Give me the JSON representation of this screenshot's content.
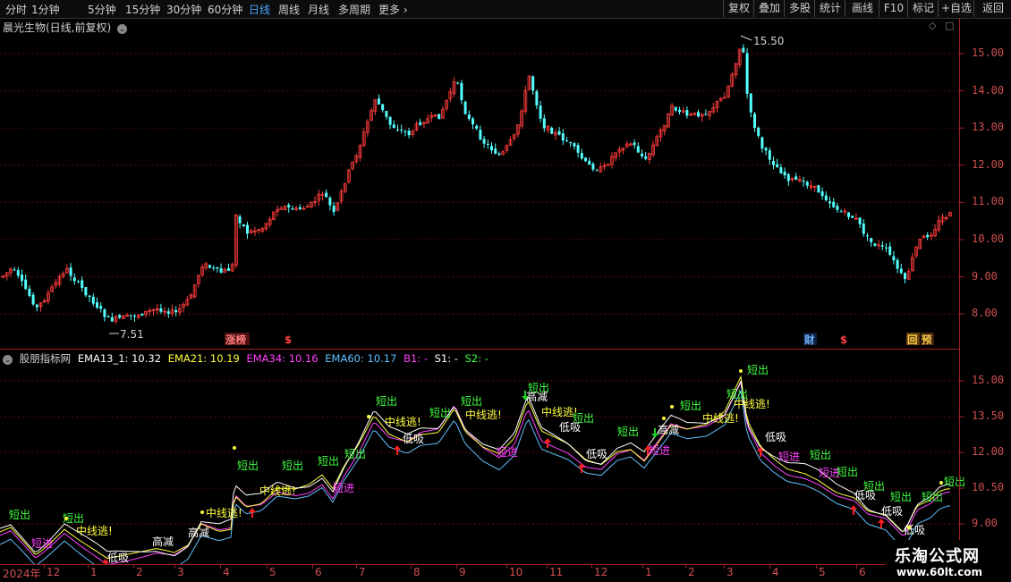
{
  "toolbar": {
    "timeframes": [
      "分时",
      "1分钟",
      "5分钟",
      "15分钟",
      "30分钟",
      "60分钟",
      "日线",
      "周线",
      "月线",
      "多周期",
      "更多"
    ],
    "active_timeframe": "日线",
    "buttons": [
      "复权",
      "叠加",
      "多股",
      "统计",
      "画线",
      "F10",
      "标记",
      "+自选",
      "返回"
    ]
  },
  "main_chart": {
    "title": "晨光生物(日线,前复权)",
    "high_label": "15.50",
    "low_label": "7.51",
    "y_ticks": [
      "15.00",
      "14.00",
      "13.00",
      "12.00",
      "11.00",
      "10.00",
      "9.00",
      "8.00"
    ],
    "markers": [
      {
        "text": "涨榜",
        "color": "#ff8080",
        "bg": "#501010"
      },
      {
        "text": "$",
        "color": "#ff4040"
      },
      {
        "text": "财",
        "color": "#6fb7ff",
        "bg": "#102040"
      },
      {
        "text": "$",
        "color": "#ff4040"
      },
      {
        "text": "回",
        "color": "#ffd04a",
        "bg": "#604010"
      },
      {
        "text": "预",
        "color": "#ffd04a",
        "bg": "#402010"
      }
    ]
  },
  "indicator": {
    "name": "股朋指标网",
    "ema13": "EMA13_1: 10.32",
    "ema21": "EMA21: 10.19",
    "ema34": "EMA34: 10.16",
    "ema60": "EMA60: 10.17",
    "b1": "B1: -",
    "s1": "S1: -",
    "s2": "S2: -",
    "colors": {
      "ema13": "#ffffff",
      "ema21": "#ffff40",
      "ema34": "#ff40ff",
      "ema60": "#60c0ff",
      "b1": "#ff40ff",
      "s1": "#ffffff",
      "s2": "#40ff40"
    },
    "y_ticks": [
      "15.00",
      "13.50",
      "12.00",
      "10.50",
      "9.00"
    ],
    "signal_words": [
      "短出",
      "短进",
      "中线逃!",
      "低吸",
      "高减"
    ]
  },
  "date_axis": {
    "labels": [
      "2024年",
      "12",
      "1",
      "2",
      "3",
      "4",
      "5",
      "6",
      "7",
      "8",
      "9",
      "10",
      "11",
      "12",
      "1",
      "2",
      "3",
      "4",
      "5",
      "6"
    ]
  },
  "watermark": {
    "title": "乐淘公式网",
    "url": "www.60lt.com"
  }
}
